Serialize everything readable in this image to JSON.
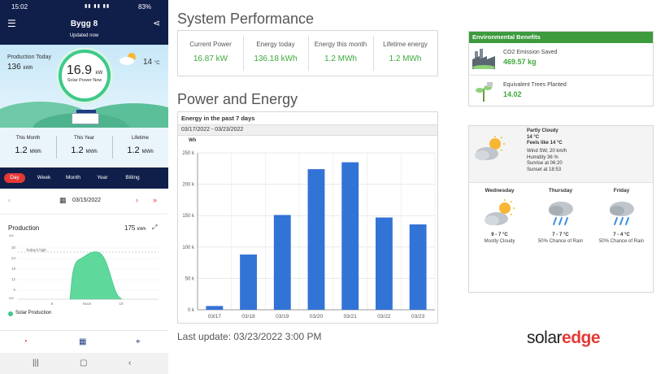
{
  "phone": {
    "status": {
      "time": "15:02",
      "battery": "83%"
    },
    "appbar": {
      "title": "Bygg 8",
      "subtitle": "Updated now"
    },
    "hero": {
      "production_today_label": "Production Today",
      "production_today_value": "136",
      "production_today_unit": "kWh",
      "power_now_value": "16.9",
      "power_now_unit": "kW",
      "power_now_label": "Solar Power Now",
      "temperature_value": "14",
      "temperature_unit": "°C"
    },
    "totals": [
      {
        "label": "This Month",
        "value": "1.2",
        "unit": "MWh"
      },
      {
        "label": "This Year",
        "value": "1.2",
        "unit": "MWh"
      },
      {
        "label": "Lifetime",
        "value": "1.2",
        "unit": "MWh"
      }
    ],
    "periods": [
      "Day",
      "Week",
      "Month",
      "Year",
      "Billing"
    ],
    "active_period": "Day",
    "date": "03/15/2022",
    "production_card": {
      "title": "Production",
      "value": "175",
      "unit": "kWh",
      "legend": "Solar Production",
      "todays_high_label": "Today's high",
      "y_unit_top": "kW",
      "y_unit_bottom": "kW",
      "y_ticks": [
        "30",
        "24",
        "18",
        "12",
        "6"
      ],
      "x_ticks": [
        "6",
        "Noon",
        "18"
      ]
    }
  },
  "system_performance": {
    "title": "System Performance",
    "kpis": [
      {
        "label": "Current Power",
        "value": "16.87 kW"
      },
      {
        "label": "Energy today",
        "value": "136.18 kWh"
      },
      {
        "label": "Energy this month",
        "value": "1.2 MWh"
      },
      {
        "label": "Lifetime energy",
        "value": "1.2 MWh"
      }
    ]
  },
  "power_energy": {
    "title": "Power and Energy",
    "chart_title": "Energy in the past 7 days",
    "date_range": "03/17/2022 - 03/23/2022",
    "unit_label": "Wh"
  },
  "chart_data": {
    "type": "bar",
    "title": "Energy in the past 7 days",
    "ylabel": "Wh",
    "categories": [
      "03/17",
      "03/18",
      "03/19",
      "03/20",
      "03/21",
      "03/22",
      "03/23"
    ],
    "values": [
      6000,
      88000,
      151000,
      224000,
      235000,
      147000,
      136000
    ],
    "ylim": [
      0,
      250000
    ],
    "y_tick_labels": [
      "0 k",
      "50 k",
      "100 k",
      "150 k",
      "200 k",
      "250 k"
    ],
    "grid": true,
    "color": "#3273d6"
  },
  "last_update": "Last update: 03/23/2022 3:00 PM",
  "logo": {
    "part1": "solar",
    "part2": "edge"
  },
  "environmental": {
    "title": "Environmental Benefits",
    "items": [
      {
        "label": "CO2 Emission Saved",
        "value": "469.57 kg",
        "icon": "factory-icon"
      },
      {
        "label": "Equivalent Trees Planted",
        "value": "14.02",
        "icon": "tree-icon"
      }
    ]
  },
  "weather": {
    "today": {
      "condition": "Partly Cloudy",
      "temp": "14 °C",
      "feels_like": "Feels like 14 °C",
      "wind": "Wind SW, 20 km/h",
      "humidity": "Humidity 36 %",
      "sunrise": "Sunrise at 06:20",
      "sunset": "Sunset at 18:53"
    },
    "forecast": [
      {
        "day": "Wednesday",
        "temps": "9 - 7 °C",
        "desc": "Mostly Cloudy",
        "icon": "partly-cloudy-icon"
      },
      {
        "day": "Thursday",
        "temps": "7 - 7 °C",
        "desc": "50% Chance of Rain",
        "icon": "rain-icon"
      },
      {
        "day": "Friday",
        "temps": "7 - 4 °C",
        "desc": "50% Chance of Rain",
        "icon": "rain-icon"
      }
    ]
  },
  "colors": {
    "navy": "#101e4a",
    "green": "#3daa3d",
    "accent_red": "#e53935",
    "bar_blue": "#3273d6"
  }
}
